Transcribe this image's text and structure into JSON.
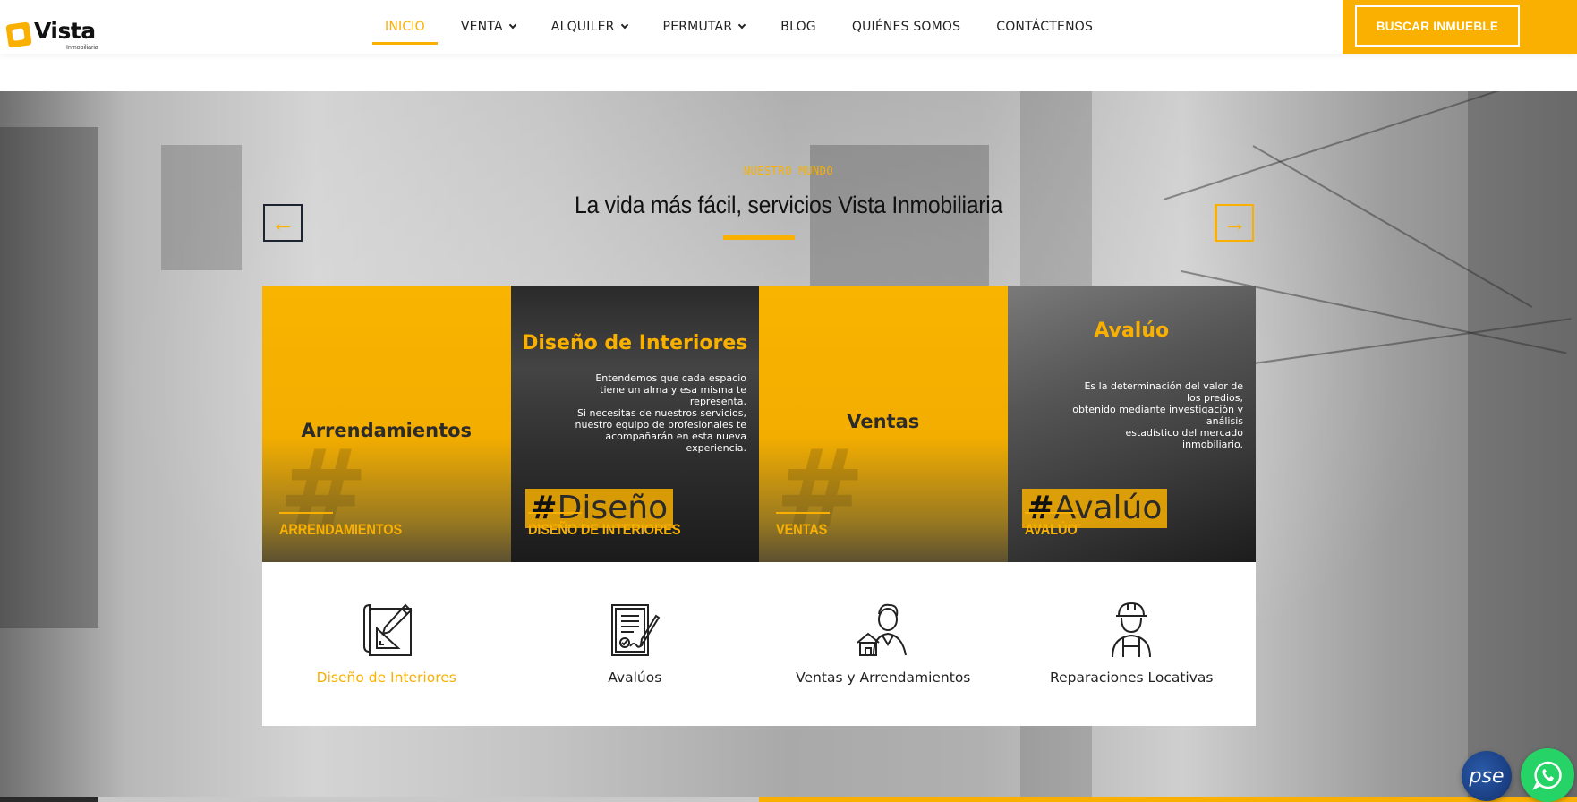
{
  "header": {
    "logo_text": "Vista",
    "logo_sub": "Inmobiliaria",
    "nav": [
      {
        "label": "INICIO",
        "active": true,
        "dropdown": false
      },
      {
        "label": "VENTA",
        "active": false,
        "dropdown": true
      },
      {
        "label": "ALQUILER",
        "active": false,
        "dropdown": true
      },
      {
        "label": "PERMUTAR",
        "active": false,
        "dropdown": true
      },
      {
        "label": "BLOG",
        "active": false,
        "dropdown": false
      },
      {
        "label": "QUIÉNES SOMOS",
        "active": false,
        "dropdown": false
      },
      {
        "label": "CONTÁCTENOS",
        "active": false,
        "dropdown": false
      }
    ],
    "search_button": "BUSCAR INMUEBLE"
  },
  "hero": {
    "kicker": "NUESTRO MUNDO",
    "headline": "La vida más fácil, servicios Vista Inmobiliaria",
    "prev_icon": "arrow-left-icon",
    "next_icon": "arrow-right-icon"
  },
  "cards": [
    {
      "title": "Arrendamientos",
      "description": "",
      "hashtag": "",
      "label": "ARRENDAMIENTOS"
    },
    {
      "title": "Diseño de Interiores",
      "description": "Entendemos que cada espacio\ntiene un alma y esa misma te\nrepresenta.\nSi necesitas de nuestros servicios,\nnuestro equipo de profesionales te\nacompañarán en esta nueva\nexperiencia.",
      "hashtag": "Diseño",
      "label": "DISEÑO DE INTERIORES"
    },
    {
      "title": "Ventas",
      "description": "",
      "hashtag": "",
      "label": "VENTAS"
    },
    {
      "title": "Avalúo",
      "description": "Es la determinación del valor de\nlos predios,\nobtenido mediante investigación y\nanálisis\nestadístico del mercado\ninmobiliario.",
      "hashtag": "Avalúo",
      "label": "AVALÚO"
    }
  ],
  "services": [
    {
      "label": "Diseño de Interiores",
      "icon": "blueprint-icon",
      "highlighted": true
    },
    {
      "label": "Avalúos",
      "icon": "contract-signature-icon",
      "highlighted": false
    },
    {
      "label": "Ventas y Arrendamientos",
      "icon": "agent-house-icon",
      "highlighted": false
    },
    {
      "label": "Reparaciones Locativas",
      "icon": "worker-helmet-icon",
      "highlighted": false
    }
  ],
  "floating": {
    "pse_label": "pse",
    "whatsapp_icon": "whatsapp-icon"
  },
  "colors": {
    "accent": "#f9b000",
    "text": "#222222",
    "whatsapp": "#26d366",
    "pse": "#1a3f8a"
  }
}
